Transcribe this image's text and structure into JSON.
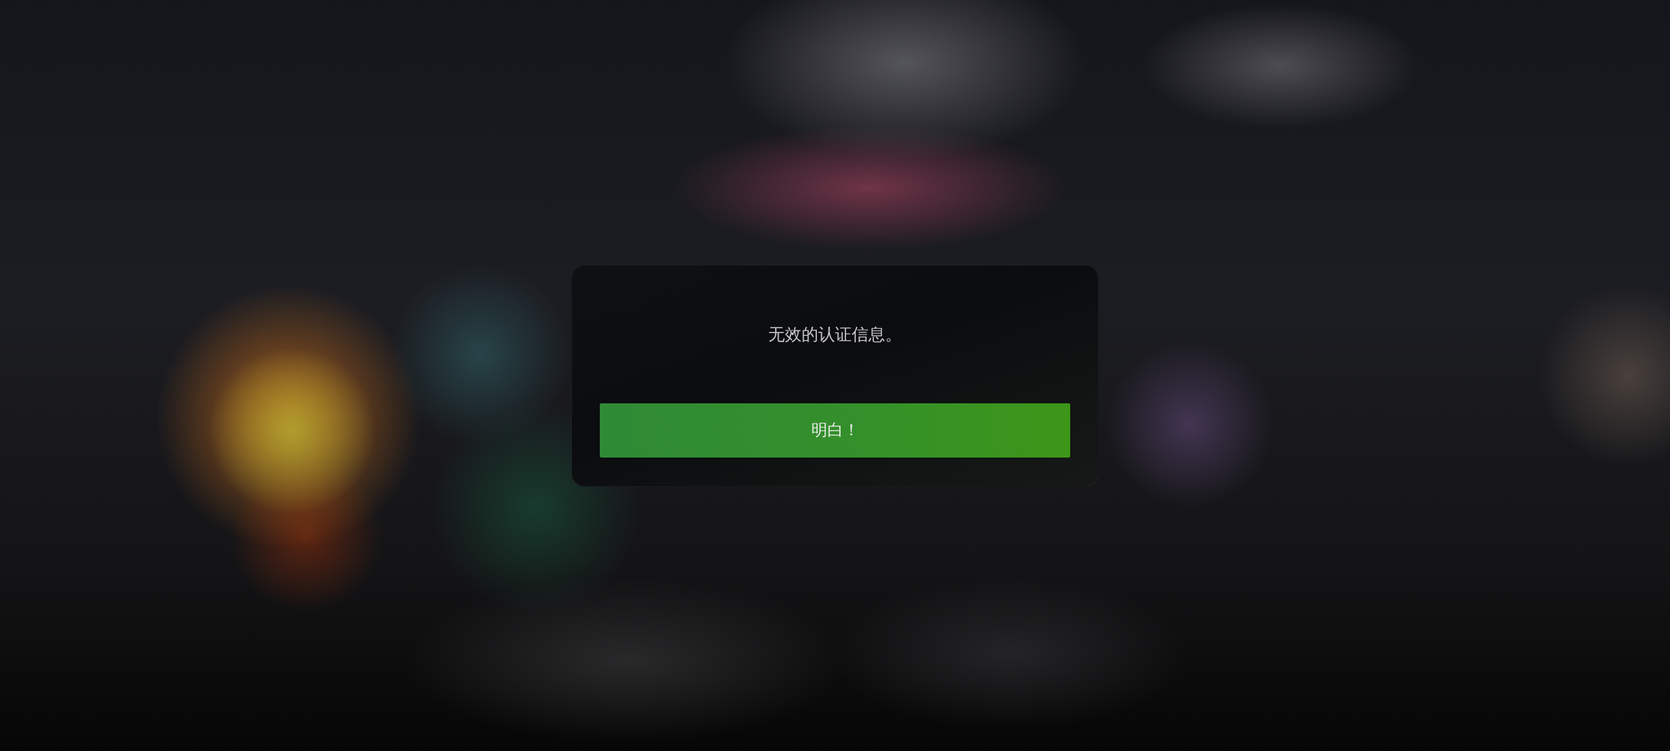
{
  "dialog": {
    "message": "无效的认证信息。",
    "button": {
      "label": "明白！"
    }
  }
}
